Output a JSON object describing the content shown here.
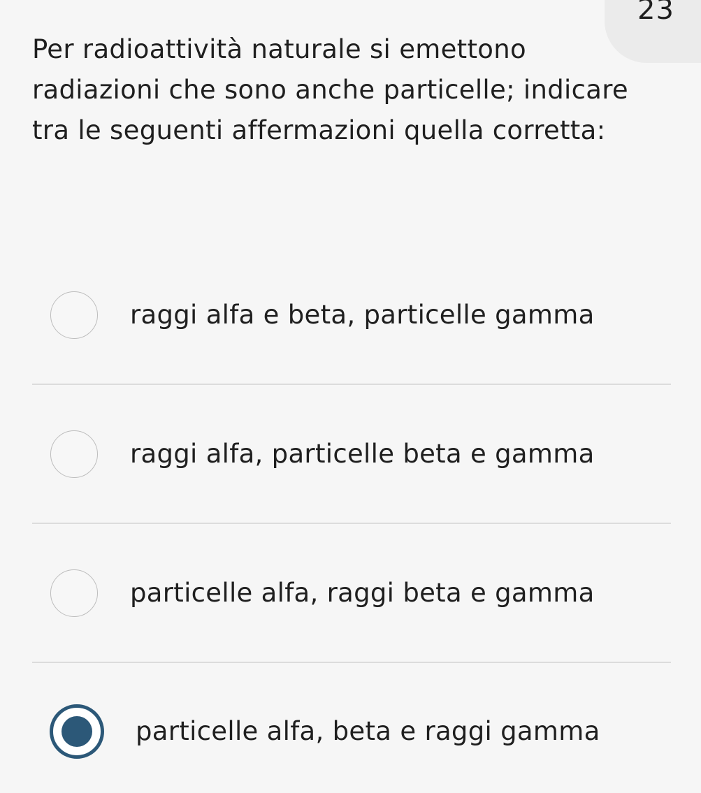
{
  "question": {
    "number": "23",
    "text": "Per radioattività naturale si emettono radiazioni che sono anche particelle; indicare tra le seguenti affermazioni quella corretta:"
  },
  "options": [
    {
      "label": "raggi alfa e beta, particelle gamma",
      "selected": false
    },
    {
      "label": "raggi alfa, particelle beta e gamma",
      "selected": false
    },
    {
      "label": "particelle alfa, raggi beta e gamma",
      "selected": false
    },
    {
      "label": "particelle alfa, beta e raggi gamma",
      "selected": true
    }
  ],
  "colors": {
    "accent": "#2c5878",
    "background": "#f6f6f6",
    "badge": "#ebebeb",
    "divider": "#dcdcdc"
  }
}
